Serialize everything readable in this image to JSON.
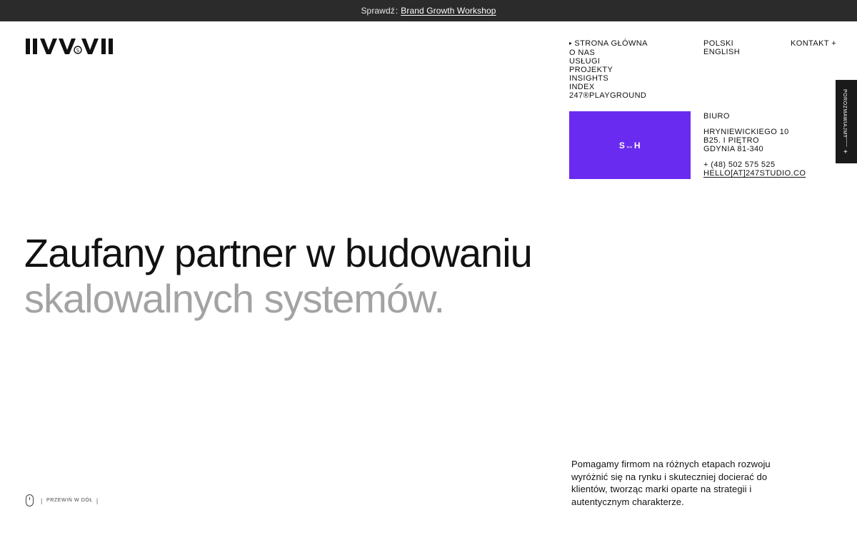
{
  "announcement": {
    "prefix": "Sprawdź",
    "separator": ":",
    "link_label": "Brand Growth Workshop"
  },
  "logo": {
    "icon": "studio-wordmark-icon"
  },
  "nav": {
    "items": [
      {
        "label": "STRONA GŁÓWNA",
        "active": true
      },
      {
        "label": "O NAS"
      },
      {
        "label": "USŁUGI"
      },
      {
        "label": "PROJEKTY"
      },
      {
        "label": "INSIGHTS"
      },
      {
        "label": "INDEX"
      },
      {
        "label": "247®PLAYGROUND"
      }
    ],
    "active_marker": "▸"
  },
  "languages": [
    "POLSKI",
    "ENGLISH"
  ],
  "contact_link": "KONTAKT +",
  "promo": {
    "label": "S↔H",
    "color": "#6a2bf0"
  },
  "office": {
    "label": "BIURO",
    "address": [
      "HRYNIEWICKIEGO 10",
      "B25. I PIĘTRO",
      "GDYNIA 81-340"
    ],
    "phone": "+ (48) 502 575 525",
    "email": "HELLO[AT]247STUDIO.CO"
  },
  "side_tab": {
    "label": "POROZMAWIAJMY",
    "plus": "+"
  },
  "hero": {
    "line1": "Zaufany partner w budowaniu",
    "line2": "skalowalnych systemów."
  },
  "scroll_hint": {
    "label": "PRZEWIŃ W DÓŁ",
    "bar": "|"
  },
  "description": "Pomagamy firmom na różnych etapach rozwoju wyróżnić się na rynku i skuteczniej docierać do klientów, tworząc marki oparte na strategii i autentycznym charakterze."
}
